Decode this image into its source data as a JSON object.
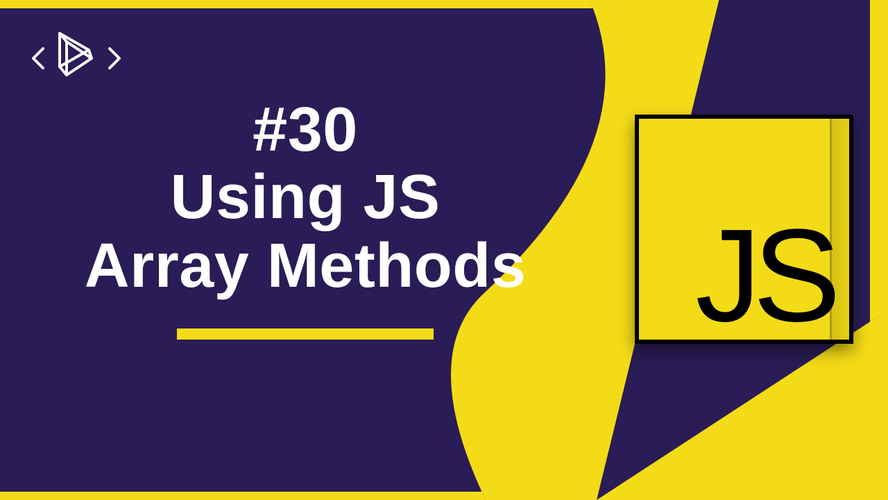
{
  "colors": {
    "bg": "#f4db17",
    "panel": "#2a1c56",
    "text": "#ffffff",
    "black": "#000000"
  },
  "title": {
    "number": "#30",
    "line1": "Using JS",
    "line2": "Array Methods"
  },
  "jslogo": {
    "letters": "JS"
  }
}
